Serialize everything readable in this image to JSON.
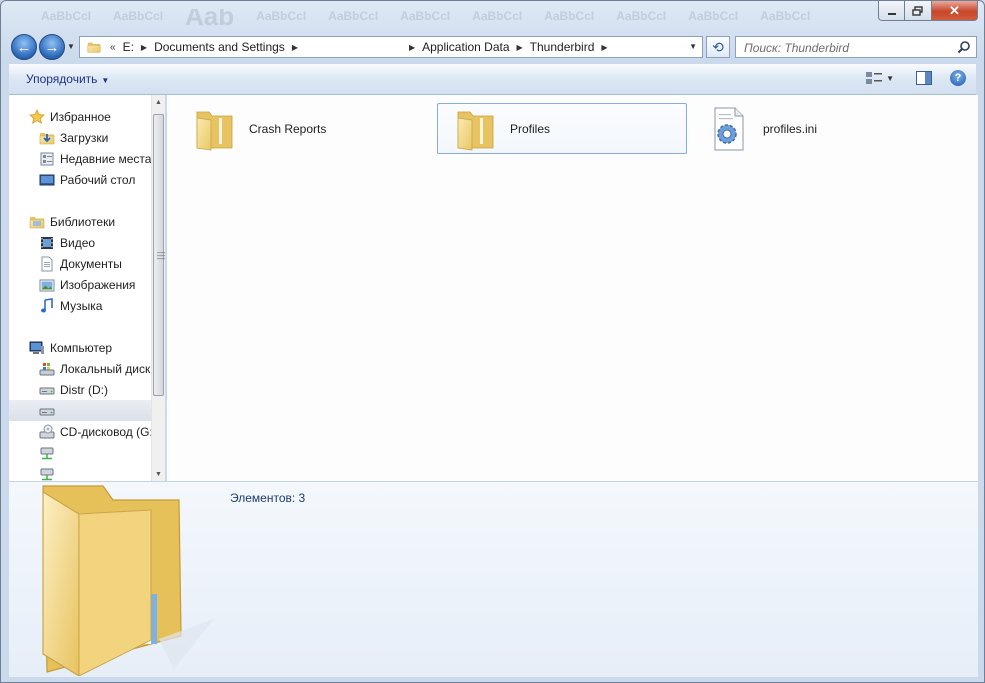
{
  "window": {
    "ghost_text": [
      "AaBbCcI",
      "AaBbCcI",
      "Aab",
      "AaBbCcI",
      "AaBbCcI",
      "AaBbCcI",
      "AaBbCcI",
      "AaBbCcI",
      "AaBbCcI",
      "AaBbCcI",
      "AaBbCcI"
    ]
  },
  "nav": {
    "address": {
      "crumbs": [
        "E:",
        "Documents and Settings",
        "Application Data",
        "Thunderbird"
      ]
    },
    "search_placeholder": "Поиск: Thunderbird"
  },
  "toolbar": {
    "organize_label": "Упорядочить"
  },
  "navpane": {
    "favorites": {
      "label": "Избранное",
      "items": [
        "Загрузки",
        "Недавние места",
        "Рабочий стол"
      ]
    },
    "libraries": {
      "label": "Библиотеки",
      "items": [
        "Видео",
        "Документы",
        "Изображения",
        "Музыка"
      ]
    },
    "computer": {
      "label": "Компьютер",
      "items": [
        "Локальный диск",
        "Distr (D:)",
        "",
        "CD-дисковод (G:",
        "",
        ""
      ]
    }
  },
  "content": {
    "items": [
      {
        "name": "Crash Reports",
        "type": "folder",
        "selected": false
      },
      {
        "name": "Profiles",
        "type": "folder",
        "selected": true
      },
      {
        "name": "profiles.ini",
        "type": "ini-file",
        "selected": false
      }
    ]
  },
  "details": {
    "count_text": "Элементов: 3"
  },
  "colors": {
    "accent_link": "#1e3287",
    "selection_border": "#84acdd",
    "folder_yellow": "#f3d98a"
  }
}
